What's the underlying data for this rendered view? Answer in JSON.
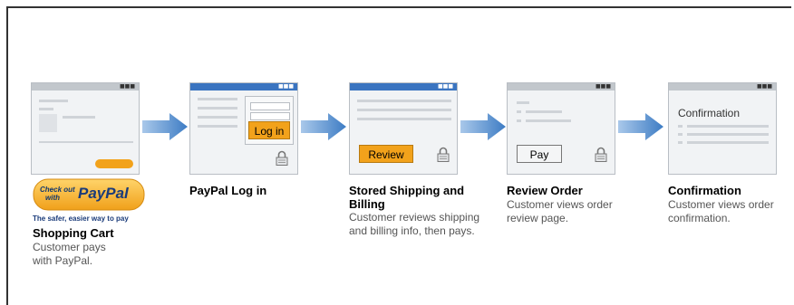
{
  "colors": {
    "accent_blue": "#3a74c0",
    "arrow_blue": "#4a86c8",
    "button_orange": "#f2a21b",
    "title_text": "#000000",
    "desc_text": "#555555"
  },
  "paypal_badge": {
    "line1": "Check out",
    "line2": "with",
    "brand": "PayPal",
    "tagline": "The safer, easier way to pay"
  },
  "steps": [
    {
      "title": "Shopping Cart",
      "desc": "Customer pays with PayPal.",
      "icon": "browser-window-icon"
    },
    {
      "title": "PayPal Log in",
      "desc": "",
      "button": "Log in",
      "icon": "lock-icon"
    },
    {
      "title": "Stored Shipping and Billing",
      "desc": "Customer reviews shipping and billing info, then pays.",
      "button": "Review",
      "icon": "lock-icon"
    },
    {
      "title": "Review Order",
      "desc": "Customer views order review page.",
      "button": "Pay",
      "icon": "lock-icon"
    },
    {
      "title": "Confirmation",
      "desc": "Customer views order confirmation.",
      "window_heading": "Confirmation"
    }
  ]
}
